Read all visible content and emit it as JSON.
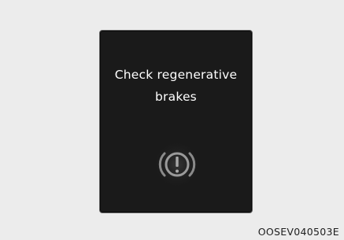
{
  "display": {
    "message_line1": "Check regenerative",
    "message_line2": "brakes",
    "icon": "regenerative-brake-warning-icon"
  },
  "image_code": "OOSEV040503E",
  "colors": {
    "page_background": "#ececec",
    "display_background": "#1a1a1a",
    "message_text": "#ffffff",
    "icon_gray": "#8c8c8c"
  }
}
